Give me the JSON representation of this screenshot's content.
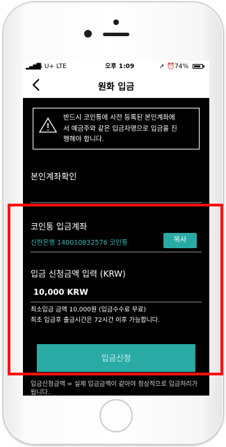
{
  "status_bar": {
    "carrier": "LG U+  LTE",
    "time": "오후 1:09",
    "battery": "74%"
  },
  "nav": {
    "back_icon": "chevron-left-icon",
    "title": "원화 입금"
  },
  "notice": {
    "icon": "warning-triangle-icon",
    "lines": [
      "반드시 코인통에 사전 등록된 본인계좌에",
      "서 예금주와 같은 입금자명으로 입금을 진",
      "행해야 합니다."
    ]
  },
  "verify": {
    "title": "본인계좌확인"
  },
  "deposit_account": {
    "title": "코인통 입금계좌",
    "account": "신한은행 140010832576 코인통",
    "copy_label": "복사"
  },
  "amount": {
    "title": "입금 신청금액 입력 (KRW)",
    "value": "10,000 KRW"
  },
  "info": {
    "line1": "최소입금 금액 10,000원 (입금수수료 무료)",
    "line2": "최초 입금후 출금시간은 72시간 이후 가능합니다."
  },
  "submit_label": "입금신청",
  "footnote": "입금신청금액 = 실제 입금금액이 같아야 정상적으로 입금처리가 됩니다.",
  "colors": {
    "accent": "#2aaaa5",
    "account_text": "#2fbcb9",
    "highlight": "#ff1010",
    "background": "#000000"
  }
}
